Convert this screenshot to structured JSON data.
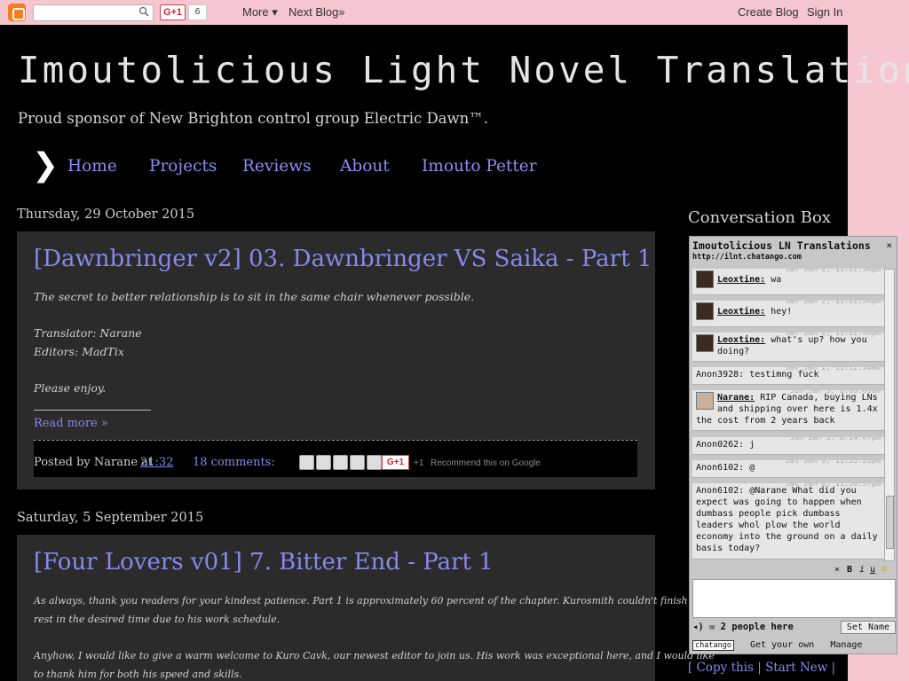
{
  "navbar": {
    "gplus": "G+1",
    "gcount": "6",
    "more": "More ▾",
    "next_blog": "Next Blog»",
    "create_blog": "Create Blog",
    "sign_in": "Sign In"
  },
  "blog": {
    "title": "Imoutolicious Light Novel Translations",
    "description": "Proud sponsor of New Brighton control group Electric Dawn™."
  },
  "tabs": [
    {
      "label": "Home"
    },
    {
      "label": "Projects"
    },
    {
      "label": "Reviews"
    },
    {
      "label": "About"
    },
    {
      "label": "Imouto Petter"
    }
  ],
  "posts": [
    {
      "date": "Thursday, 29 October 2015",
      "title": "[Dawnbringer v2] 03. Dawnbringer VS Saika - Part 1",
      "lines": [
        "The secret to better relationship is to sit in the same chair whenever possible.",
        "Translator: Narane",
        "Editors: MadTix",
        "Please enjoy."
      ],
      "read_more": "Read more »",
      "posted_by": "Posted by Narane at",
      "time": "21:32",
      "comments": "18 comments:",
      "gplus": "G+1",
      "plus1": "+1",
      "recommend": "Recommend this on Google"
    },
    {
      "date": "Saturday, 5 September 2015",
      "title": "[Four Lovers v01] 7. Bitter End - Part 1",
      "lines": [
        "As always, thank you readers for your kindest patience. Part 1 is approximately 60 percent of the chapter. Kurosmith couldn't finish the",
        "rest in the desired time due to his work schedule.",
        "Anyhow, I would like to give a warm welcome to Kuro Cavk, our newest editor to join us. His work was exceptional here, and I would like",
        "to thank him for both his speed and skills."
      ]
    }
  ],
  "sidebar": {
    "title": "Conversation Box",
    "links_line": "[ Copy this | Start New |"
  },
  "chat": {
    "header": "Imoutolicious LN Translations",
    "url": "http://ilnt.chatango.com",
    "messages": [
      {
        "name": "Leoxtine:",
        "text": "wa",
        "ts": "Sat Jan 2, 11:12:34pm"
      },
      {
        "name": "Leoxtine:",
        "text": "hey!",
        "ts": "Sat Jan 2, 11:12:34pm"
      },
      {
        "name": "Leoxtine:",
        "text": "what's up? how you doing?",
        "ts": "Sat Jan 2, 11:12:48pm"
      },
      {
        "name": "",
        "text": "Anon3928: testimng fuck",
        "ts": "Sat Jan 2, 11:12:54am"
      },
      {
        "name": "Narane:",
        "text": "RIP Canada, buying LNs and shipping over here is 1.4x the cost from 2 years back",
        "ts": "Sun Jan 3, 8:08:09am"
      },
      {
        "name": "",
        "text": "Anon0262: j",
        "ts": "Sun Jan 3, 8:14:07pm"
      },
      {
        "name": "",
        "text": "Anon6102: @",
        "ts": "Sat Jan 8, 11:55:26pm"
      },
      {
        "name": "",
        "text": "Anon6102: @Narane What did you expect was going to happen when dumbass people pick dumbass leaders whol plow the world economy into the ground on a daily basis today?",
        "ts": "Sat Jan 8, 11:56:57pm"
      }
    ],
    "people": "2 people here",
    "set_name": "Set Name",
    "logo": "chatango",
    "get_own": "Get your own",
    "manage": "Manage"
  },
  "colors": {
    "link": "#8888ee",
    "navbar_bg": "#f5c6cf",
    "post_bg": "#2b2b2b"
  }
}
